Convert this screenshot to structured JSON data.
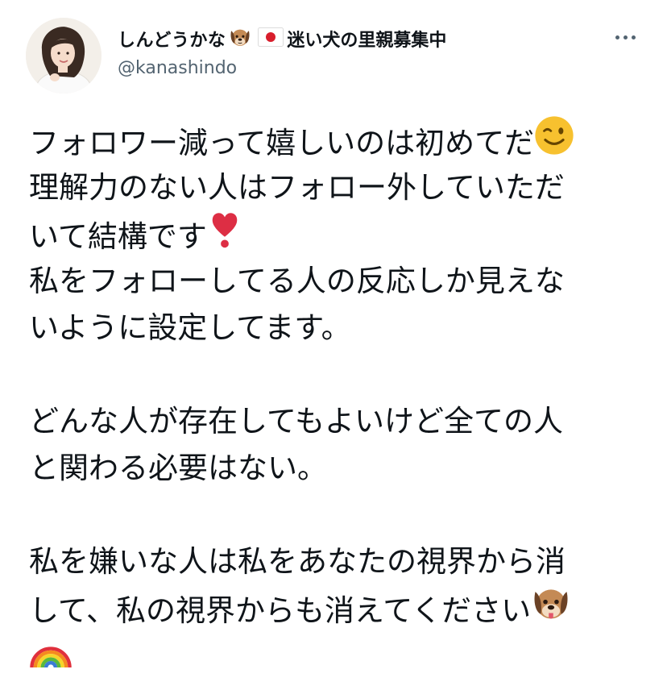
{
  "author": {
    "display_name": "しんどうかな",
    "name_suffix": "迷い犬の里親募集中",
    "handle": "@kanashindo"
  },
  "icons": {
    "name_emojis": [
      "dog-face-icon",
      "japan-flag-icon"
    ],
    "menu": "more-horizontal-icon",
    "body_emojis": [
      "winking-face-icon",
      "heavy-exclamation-heart-icon",
      "dog-face-icon",
      "rainbow-icon"
    ]
  },
  "tweet": {
    "lines": [
      "フォロワー減って嬉しいのは初めてだ",
      "理解力のない人はフォロー外していただ",
      "いて結構です",
      "私をフォローしてる人の反応しか見えな",
      "いように設定してます。",
      "",
      "どんな人が存在してもよいけど全ての人",
      "と関わる必要はない。",
      "",
      "私を嫌いな人は私をあなたの視界から消",
      "して、私の視界からも消えてください"
    ]
  },
  "colors": {
    "text": "#0f1419",
    "secondary": "#536471",
    "background": "#ffffff"
  }
}
